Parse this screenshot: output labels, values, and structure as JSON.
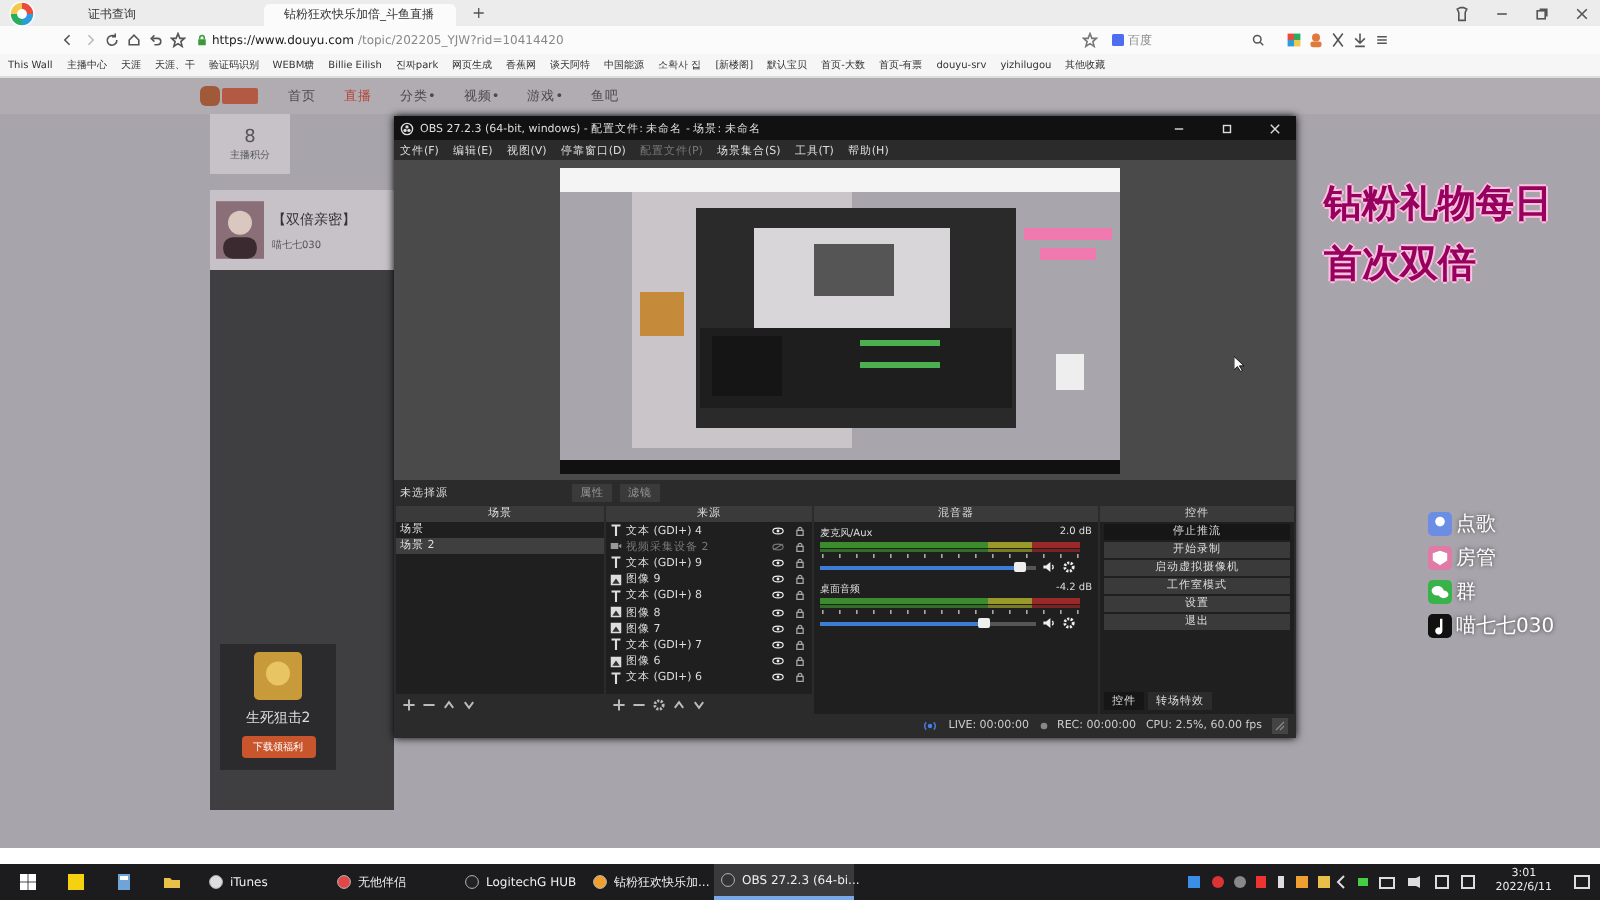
{
  "browser": {
    "tabs": [
      {
        "title": "证书查询",
        "selected": false
      },
      {
        "title": "钻粉狂欢快乐加倍_斗鱼直播",
        "selected": true
      }
    ],
    "new_tab": "+",
    "url_host": "https://www.douyu.com",
    "url_path": "/topic/202205_YJW?rid=10414420",
    "search_placeholder": "百度",
    "bookmarks": [
      "This Wall",
      "主播中心",
      "天涯",
      "天涯、干",
      "验证码识别",
      "WEBM糖",
      "Billie Eilish",
      "진짜park",
      "网页生成",
      "香蕉网",
      "谈天阿特",
      "中国能源",
      "소확사 집",
      "[新楼阁]",
      "默认宝贝",
      "首页-大数",
      "首页-有票",
      "douyu-srv",
      "yizhilugou",
      "其他收藏"
    ]
  },
  "douyu": {
    "nav": [
      {
        "label": "首页",
        "selected": false
      },
      {
        "label": "直播",
        "selected": true
      },
      {
        "label": "分类•",
        "selected": false
      },
      {
        "label": "视频•",
        "selected": false
      },
      {
        "label": "游戏•",
        "selected": false
      },
      {
        "label": "鱼吧",
        "selected": false
      }
    ],
    "points_value": "8",
    "points_label": "主播积分",
    "card_title": "【双倍亲密】",
    "card_name": "喵七七030",
    "ad_title": "生死狙击2",
    "ad_button": "下载领福利"
  },
  "overlay": {
    "lines": [
      "钻粉礼物每日",
      "首次双倍"
    ],
    "social": [
      {
        "kind": "song",
        "label": "点歌"
      },
      {
        "kind": "admin",
        "label": "房管"
      },
      {
        "kind": "chat",
        "label": "群"
      },
      {
        "kind": "music",
        "label": "喵七七030"
      }
    ]
  },
  "obs": {
    "title": "OBS 27.2.3 (64-bit, windows) - 配置文件: 未命名 - 场景: 未命名",
    "menu": [
      {
        "label": "文件(F)",
        "disabled": false
      },
      {
        "label": "编辑(E)",
        "disabled": false
      },
      {
        "label": "视图(V)",
        "disabled": false
      },
      {
        "label": "停靠窗口(D)",
        "disabled": false
      },
      {
        "label": "配置文件(P)",
        "disabled": true
      },
      {
        "label": "场景集合(S)",
        "disabled": false
      },
      {
        "label": "工具(T)",
        "disabled": false
      },
      {
        "label": "帮助(H)",
        "disabled": false
      }
    ],
    "source_bar": {
      "label": "未选择源",
      "buttons": [
        "属性",
        "滤镜"
      ]
    },
    "docks": {
      "scenes": "场景",
      "sources": "来源",
      "mixer": "混音器",
      "controls": "控件"
    },
    "scenes": [
      {
        "name": "场景",
        "selected": false
      },
      {
        "name": "场景 2",
        "selected": true
      }
    ],
    "sources": [
      {
        "kind": "text",
        "name": "文本 (GDI+) 4",
        "visible": true
      },
      {
        "kind": "video",
        "name": "视频采集设备 2",
        "visible": false
      },
      {
        "kind": "text",
        "name": "文本 (GDI+) 9",
        "visible": true
      },
      {
        "kind": "image",
        "name": "图像 9",
        "visible": true
      },
      {
        "kind": "text",
        "name": "文本 (GDI+) 8",
        "visible": true
      },
      {
        "kind": "image",
        "name": "图像 8",
        "visible": true
      },
      {
        "kind": "image",
        "name": "图像 7",
        "visible": true
      },
      {
        "kind": "text",
        "name": "文本 (GDI+) 7",
        "visible": true
      },
      {
        "kind": "image",
        "name": "图像 6",
        "visible": true
      },
      {
        "kind": "text",
        "name": "文本 (GDI+) 6",
        "visible": true
      }
    ],
    "channels": [
      {
        "name": "麦克风/Aux",
        "reading": "2.0 dB",
        "level": 0.93
      },
      {
        "name": "桌面音频",
        "reading": "-4.2 dB",
        "level": 0.76
      }
    ],
    "controls": [
      {
        "label": "停止推流",
        "active": true
      },
      {
        "label": "开始录制",
        "active": false
      },
      {
        "label": "启动虚拟摄像机",
        "active": false
      },
      {
        "label": "工作室模式",
        "active": false
      },
      {
        "label": "设置",
        "active": false
      },
      {
        "label": "退出",
        "active": false
      }
    ],
    "control_tabs": [
      {
        "label": "控件",
        "selected": true
      },
      {
        "label": "转场特效",
        "selected": false
      }
    ],
    "status": {
      "live": "LIVE: 00:00:00",
      "rec": "REC: 00:00:00",
      "cpu": "CPU: 2.5%, 60.00 fps"
    }
  },
  "taskbar": {
    "apps": [
      {
        "label": "iTunes",
        "selected": false
      },
      {
        "label": "无他伴侣",
        "selected": false
      },
      {
        "label": "LogitechG HUB",
        "selected": false
      },
      {
        "label": "钻粉狂欢快乐加...",
        "selected": false
      },
      {
        "label": "OBS 27.2.3 (64-bi...",
        "selected": true
      }
    ],
    "time": "3:01",
    "date": "2022/6/11"
  }
}
